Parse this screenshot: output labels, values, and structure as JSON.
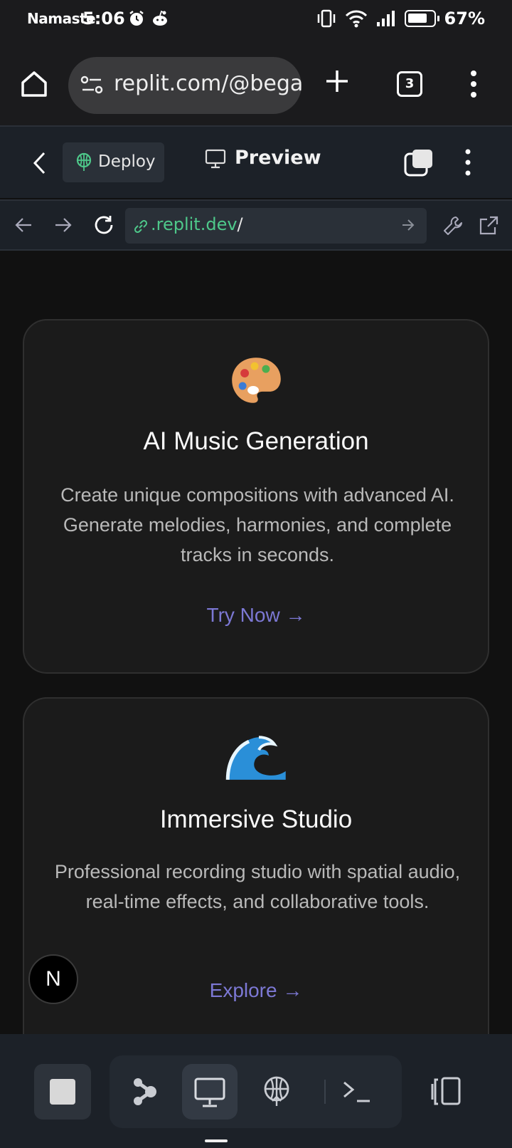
{
  "status": {
    "carrier": "Namaste",
    "time": "5:06",
    "battery": "67%"
  },
  "browser": {
    "url": "replit.com/@bega",
    "tab_count": "3"
  },
  "replit_bar": {
    "deploy_label": "Deploy",
    "preview_label": "Preview"
  },
  "webview": {
    "address": ".replit.dev",
    "address_suffix": "/"
  },
  "cards": [
    {
      "emoji": "🎨",
      "title": "AI Music Generation",
      "description": "Create unique compositions with advanced AI. Generate melodies, harmonies, and complete tracks in seconds.",
      "action": "Try Now →"
    },
    {
      "emoji": "🌊",
      "title": "Immersive Studio",
      "description": "Professional recording studio with spatial audio, real-time effects, and collaborative tools.",
      "action": "Explore →"
    }
  ],
  "badge": "N",
  "colors": {
    "accent_link": "#7c78d4",
    "url_green": "#4ec88a",
    "replit_bar_bg": "#1c2128"
  }
}
